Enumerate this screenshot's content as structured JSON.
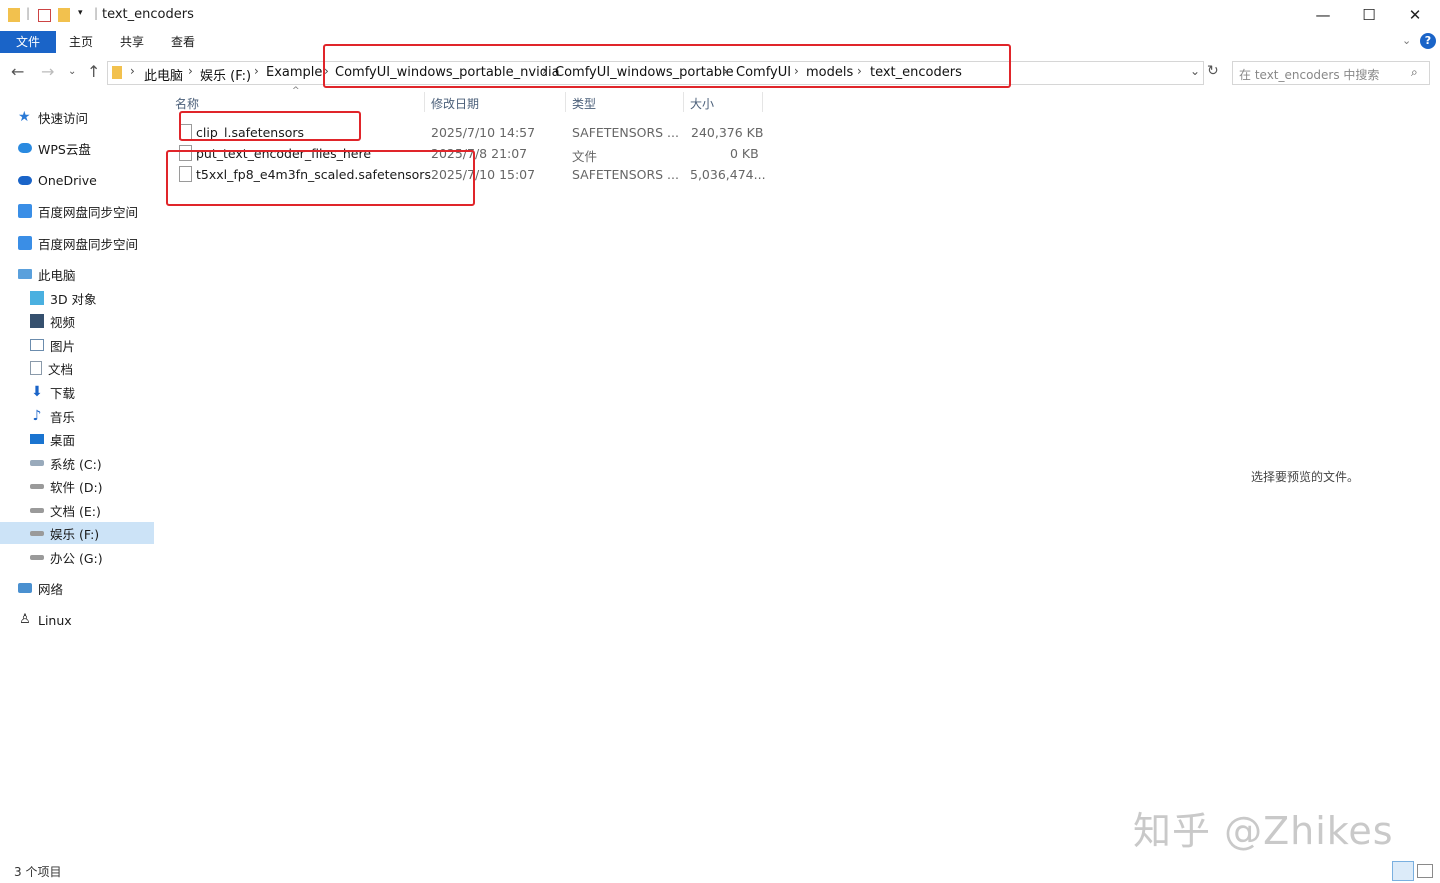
{
  "window": {
    "title": "text_encoders",
    "controls": {
      "minimize": "—",
      "maximize": "☐",
      "close": "✕"
    }
  },
  "ribbon": {
    "tabs": [
      "文件",
      "主页",
      "共享",
      "查看"
    ]
  },
  "address": {
    "crumbs": [
      "此电脑",
      "娱乐 (F:)",
      "Example",
      "ComfyUI_windows_portable_nvidia",
      "ComfyUI_windows_portable",
      "ComfyUI",
      "models",
      "text_encoders"
    ],
    "search_placeholder": "在 text_encoders 中搜索"
  },
  "sidebar": {
    "items": [
      {
        "label": "快速访问",
        "icon": "star-icon"
      },
      {
        "label": "WPS云盘",
        "icon": "cloud-icon"
      },
      {
        "label": "OneDrive",
        "icon": "cloud-icon"
      },
      {
        "label": "百度网盘同步空间",
        "icon": "baidu-sync-icon"
      },
      {
        "label": "百度网盘同步空间",
        "icon": "baidu-sync-icon"
      },
      {
        "label": "此电脑",
        "icon": "computer-icon"
      },
      {
        "label": "3D 对象",
        "icon": "cube-icon"
      },
      {
        "label": "视频",
        "icon": "film-icon"
      },
      {
        "label": "图片",
        "icon": "picture-icon"
      },
      {
        "label": "文档",
        "icon": "document-icon"
      },
      {
        "label": "下载",
        "icon": "download-icon"
      },
      {
        "label": "音乐",
        "icon": "music-icon"
      },
      {
        "label": "桌面",
        "icon": "desktop-icon"
      },
      {
        "label": "系统 (C:)",
        "icon": "drive-icon"
      },
      {
        "label": "软件 (D:)",
        "icon": "drive-icon"
      },
      {
        "label": "文档 (E:)",
        "icon": "drive-icon"
      },
      {
        "label": "娱乐 (F:)",
        "icon": "drive-icon"
      },
      {
        "label": "办公 (G:)",
        "icon": "drive-icon"
      },
      {
        "label": "网络",
        "icon": "network-icon"
      },
      {
        "label": "Linux",
        "icon": "linux-icon"
      }
    ]
  },
  "filelist": {
    "columns": [
      "名称",
      "修改日期",
      "类型",
      "大小"
    ],
    "rows": [
      {
        "name": "clip_l.safetensors",
        "modified": "2025/7/10 14:57",
        "type": "SAFETENSORS ...",
        "size": "240,376 KB"
      },
      {
        "name": "put_text_encoder_files_here",
        "modified": "2025/7/8 21:07",
        "type": "文件",
        "size": "0 KB"
      },
      {
        "name": "t5xxl_fp8_e4m3fn_scaled.safetensors",
        "modified": "2025/7/10 15:07",
        "type": "SAFETENSORS ...",
        "size": "5,036,474..."
      }
    ]
  },
  "preview_text": "选择要预览的文件。",
  "status": {
    "count": "3 个项目"
  },
  "watermark": "知乎 @Zhikes",
  "colors": {
    "accent": "#1a64c8",
    "highlight": "#e0252a",
    "selected": "#cce3f7"
  }
}
